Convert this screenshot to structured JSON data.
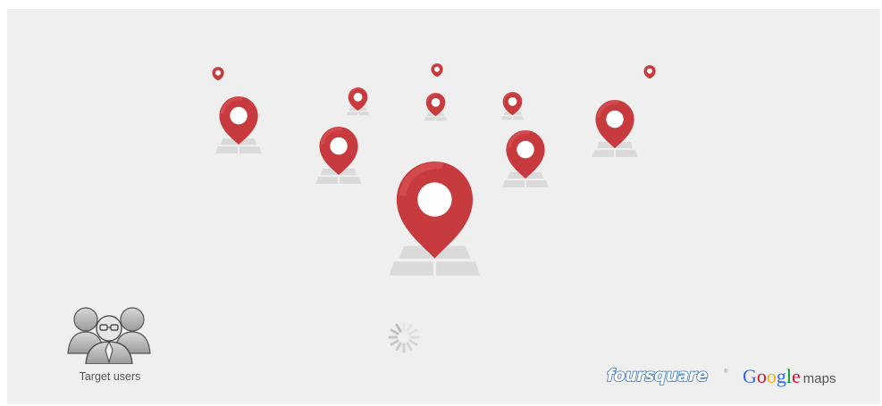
{
  "scene": {
    "background_color": "#efefef",
    "pin_color": "#c73a3e",
    "pin_highlight_color": "#dd5a5a",
    "pin_count": 12
  },
  "target_users": {
    "label": "Target users",
    "icon": "users-group-icon"
  },
  "loading": {
    "icon": "loading-spinner-icon"
  },
  "logos": {
    "foursquare": {
      "text": "foursquare",
      "trademark": "®",
      "color": "#3a78b8"
    },
    "google_maps": {
      "google_letters": [
        {
          "char": "G",
          "color": "#3369e8"
        },
        {
          "char": "o",
          "color": "#d50f25"
        },
        {
          "char": "o",
          "color": "#eeb211"
        },
        {
          "char": "g",
          "color": "#3369e8"
        },
        {
          "char": "l",
          "color": "#009925"
        },
        {
          "char": "e",
          "color": "#d50f25"
        }
      ],
      "maps_text": "maps"
    }
  }
}
